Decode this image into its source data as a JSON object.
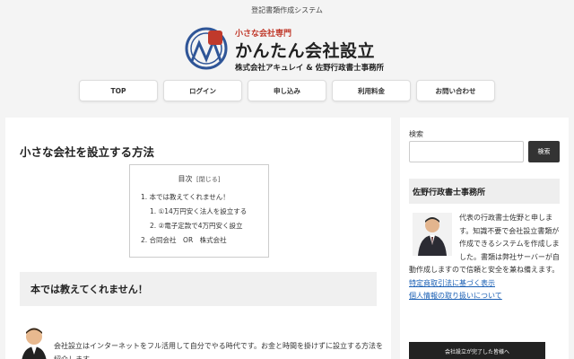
{
  "header": {
    "tagline": "登記書類作成システム",
    "logo_small": "小さな会社専門",
    "logo_main": "かんたん会社設立",
    "logo_company": "株式会社アキュレイ & 佐野行政書士事務所"
  },
  "nav": {
    "items": [
      "TOP",
      "ログイン",
      "申し込み",
      "利用料金",
      "お問い合わせ"
    ]
  },
  "main": {
    "title": "小さな会社を設立する方法",
    "toc": {
      "heading": "目次",
      "toggle": "[閉じる]",
      "items": [
        "1. 本では教えてくれません！",
        "1. ①14万円安く法人を設立する",
        "2. ②電子定款で4万円安く設立",
        "2. 合同会社　OR　株式会社"
      ]
    },
    "h2": "本では教えてくれません！",
    "intro": "会社設立はインターネットをフル活用して自分でやる時代です。お金と時間を掛けずに設立する方法を紹介します。"
  },
  "sidebar": {
    "search_label": "検索",
    "search_button": "検索",
    "office_title": "佐野行政書士事務所",
    "office_desc": "代表の行政書士佐野と申します。知識不要で会社設立書類が作成できるシステムを作成しました。書類は弊社サーバーが自動作成しますので信頼と安全を兼ね備えます。",
    "link_tokusho": "特定商取引法に基づく表示",
    "link_privacy": "個人情報の取り扱いについて",
    "banner": "会社設立が完了した皆様へ"
  },
  "colors": {
    "accent_red": "#c0392b",
    "seal_blue": "#2f5597",
    "link": "#1a5fb4"
  }
}
